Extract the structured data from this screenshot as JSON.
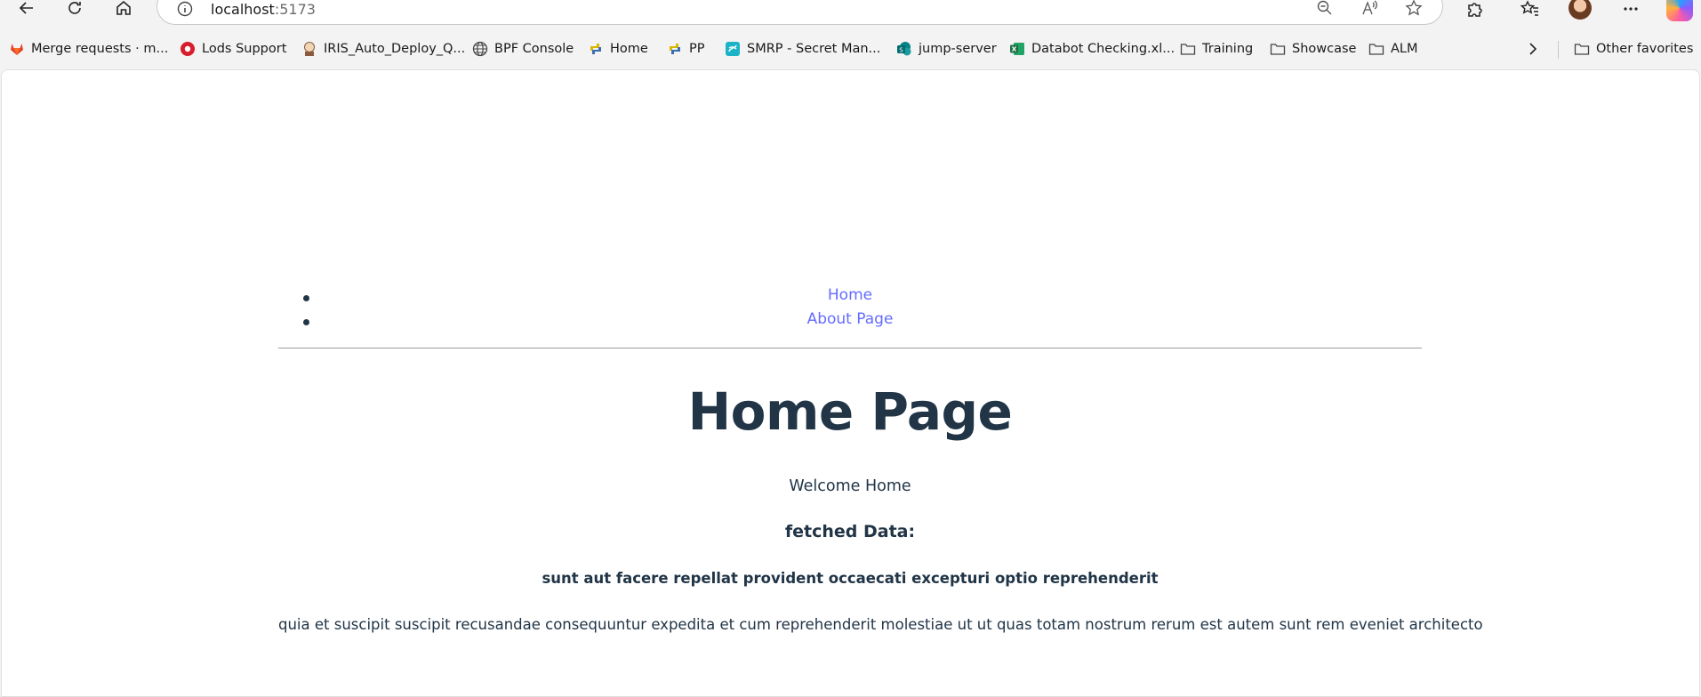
{
  "browser": {
    "url_host": "localhost",
    "url_port": ":5173",
    "icons": {
      "back": "back-arrow-icon",
      "refresh": "refresh-icon",
      "home": "home-icon",
      "info": "info-icon",
      "zoom": "zoom-out-icon",
      "read_aloud": "read-aloud-icon",
      "favorite": "star-icon",
      "extensions": "puzzle-icon",
      "favorites_bar": "favorites-icon",
      "more": "more-icon"
    }
  },
  "bookmarks": [
    {
      "label": "Merge requests · m...",
      "icon": "gitlab-icon",
      "color": "#e24329"
    },
    {
      "label": "Lods Support",
      "icon": "lods-icon",
      "color": "#d81e2c"
    },
    {
      "label": "IRIS_Auto_Deploy_Q...",
      "icon": "jenkins-icon",
      "color": "#8b5a3c"
    },
    {
      "label": "BPF Console",
      "icon": "globe-icon",
      "color": "#444444"
    },
    {
      "label": "Home",
      "icon": "python-icon",
      "color": "#d9b600"
    },
    {
      "label": "PP",
      "icon": "python-icon",
      "color": "#d9b600"
    },
    {
      "label": "SMRP - Secret Man...",
      "icon": "smrp-icon",
      "color": "#1bb3c6"
    },
    {
      "label": "jump-server",
      "icon": "sharepoint-icon",
      "color": "#038387"
    },
    {
      "label": "Databot Checking.xl...",
      "icon": "excel-icon",
      "color": "#1d6f42"
    },
    {
      "label": "Training",
      "icon": "folder-icon",
      "color": "#444444"
    },
    {
      "label": "Showcase",
      "icon": "folder-icon",
      "color": "#444444"
    },
    {
      "label": "ALM",
      "icon": "folder-icon",
      "color": "#444444"
    }
  ],
  "other_favorites": "Other favorites",
  "page": {
    "nav": [
      "Home",
      "About Page"
    ],
    "heading": "Home Page",
    "welcome": "Welcome Home",
    "fetched_label": "fetched Data:",
    "post_title": "sunt aut facere repellat provident occaecati excepturi optio reprehenderit",
    "post_body": "quia et suscipit suscipit recusandae consequuntur expedita et cum reprehenderit molestiae ut ut quas totam nostrum rerum est autem sunt rem eveniet architecto",
    "link_color": "#646cff",
    "text_color": "#213547"
  }
}
